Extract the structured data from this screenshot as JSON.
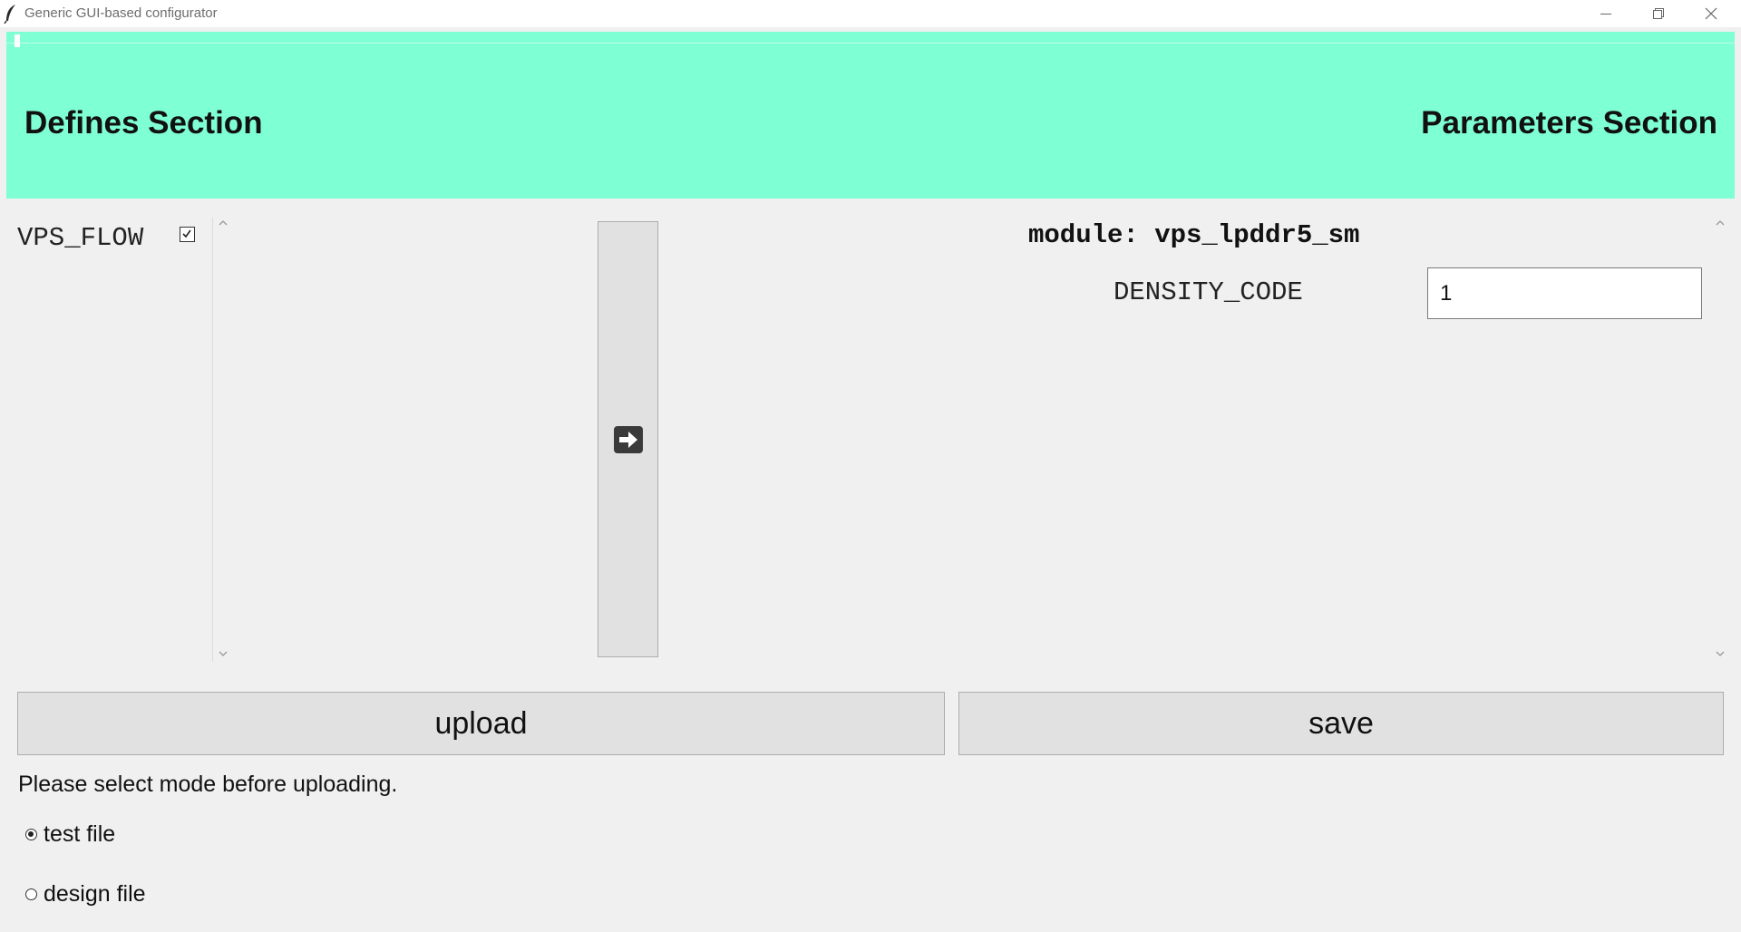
{
  "window": {
    "title": "Generic GUI-based configurator",
    "controls": [
      "minimize-icon",
      "restore-icon",
      "close-icon"
    ]
  },
  "header": {
    "defines_title": "Defines Section",
    "parameters_title": "Parameters Section",
    "background_color": "#7fffd4"
  },
  "defines": {
    "items": [
      {
        "label": "VPS_FLOW",
        "checked": true
      }
    ]
  },
  "transfer": {
    "icon": "arrow-right-icon"
  },
  "parameters": {
    "module_title": "module: vps_lpddr5_sm",
    "fields": [
      {
        "label": "DENSITY_CODE",
        "value": "1"
      }
    ]
  },
  "actions": {
    "upload_label": "upload",
    "save_label": "save"
  },
  "mode": {
    "hint": "Please select mode before uploading.",
    "options": [
      {
        "label": "test file",
        "selected": true
      },
      {
        "label": "design file",
        "selected": false
      }
    ]
  }
}
